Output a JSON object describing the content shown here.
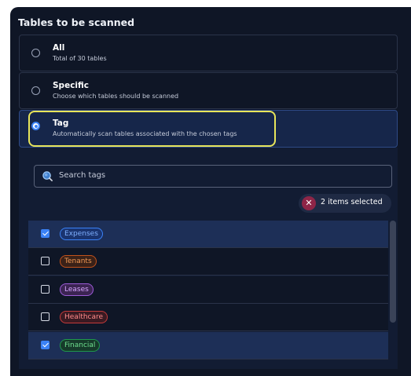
{
  "section": {
    "title": "Tables to be scanned"
  },
  "options": [
    {
      "title": "All",
      "description": "Total of 30 tables",
      "selected": false
    },
    {
      "title": "Specific",
      "description": "Choose which tables should be scanned",
      "selected": false
    },
    {
      "title": "Tag",
      "description": "Automatically scan tables associated with the chosen tags",
      "selected": true
    }
  ],
  "search": {
    "placeholder": "Search tags",
    "icon": "search-icon"
  },
  "selection": {
    "label": "2 items selected",
    "clear_icon": "close-icon"
  },
  "tags": [
    {
      "label": "Expenses",
      "checked": true,
      "color": "#3b82f6"
    },
    {
      "label": "Tenants",
      "checked": false,
      "color": "#f97316"
    },
    {
      "label": "Leases",
      "checked": false,
      "color": "#c084fc"
    },
    {
      "label": "Healthcare",
      "checked": false,
      "color": "#ef4444"
    },
    {
      "label": "Financial",
      "checked": true,
      "color": "#22c55e"
    }
  ],
  "colors": {
    "accent": "#3b82f6",
    "highlight": "#e8e55a",
    "background": "#0f1626"
  }
}
